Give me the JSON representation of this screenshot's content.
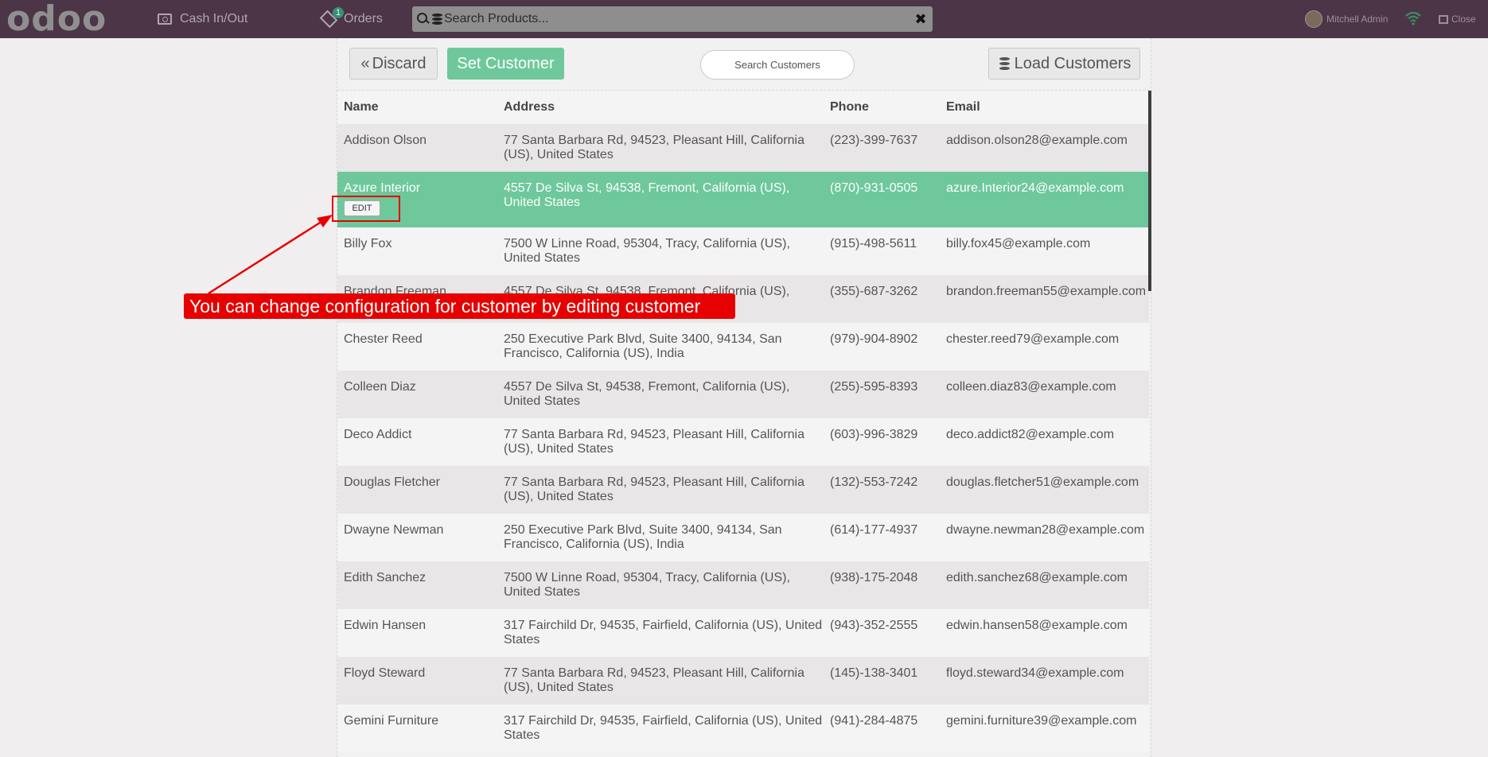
{
  "topbar": {
    "logo": "odoo",
    "cash_label": "Cash In/Out",
    "orders_label": "Orders",
    "orders_badge": "1",
    "search_placeholder": "Search Products...",
    "clear_label": "✖",
    "user_name": "Mitchell Admin",
    "close_label": "Close"
  },
  "actions": {
    "discard_label": "Discard",
    "set_customer_label": "Set Customer",
    "search_customers_placeholder": "Search Customers",
    "load_customers_label": "Load Customers"
  },
  "table": {
    "headers": [
      "Name",
      "Address",
      "Phone",
      "Email"
    ],
    "edit_label": "EDIT",
    "rows": [
      {
        "name": "Addison Olson",
        "address": "77 Santa Barbara Rd, 94523, Pleasant Hill, California (US), United States",
        "phone": "(223)-399-7637",
        "email": "addison.olson28@example.com"
      },
      {
        "name": "Azure Interior",
        "address": "4557 De Silva St, 94538, Fremont, California (US), United States",
        "phone": "(870)-931-0505",
        "email": "azure.Interior24@example.com"
      },
      {
        "name": "Billy Fox",
        "address": "7500 W Linne Road, 95304, Tracy, California (US), United States",
        "phone": "(915)-498-5611",
        "email": "billy.fox45@example.com"
      },
      {
        "name": "Brandon Freeman",
        "address": "4557 De Silva St, 94538, Fremont, California (US), United States",
        "phone": "(355)-687-3262",
        "email": "brandon.freeman55@example.com"
      },
      {
        "name": "Chester Reed",
        "address": "250 Executive Park Blvd, Suite 3400, 94134, San Francisco, California (US), India",
        "phone": "(979)-904-8902",
        "email": "chester.reed79@example.com"
      },
      {
        "name": "Colleen Diaz",
        "address": "4557 De Silva St, 94538, Fremont, California (US), United States",
        "phone": "(255)-595-8393",
        "email": "colleen.diaz83@example.com"
      },
      {
        "name": "Deco Addict",
        "address": "77 Santa Barbara Rd, 94523, Pleasant Hill, California (US), United States",
        "phone": "(603)-996-3829",
        "email": "deco.addict82@example.com"
      },
      {
        "name": "Douglas Fletcher",
        "address": "77 Santa Barbara Rd, 94523, Pleasant Hill, California (US), United States",
        "phone": "(132)-553-7242",
        "email": "douglas.fletcher51@example.com"
      },
      {
        "name": "Dwayne Newman",
        "address": "250 Executive Park Blvd, Suite 3400, 94134, San Francisco, California (US), India",
        "phone": "(614)-177-4937",
        "email": "dwayne.newman28@example.com"
      },
      {
        "name": "Edith Sanchez",
        "address": "7500 W Linne Road, 95304, Tracy, California (US), United States",
        "phone": "(938)-175-2048",
        "email": "edith.sanchez68@example.com"
      },
      {
        "name": "Edwin Hansen",
        "address": "317 Fairchild Dr, 94535, Fairfield, California (US), United States",
        "phone": "(943)-352-2555",
        "email": "edwin.hansen58@example.com"
      },
      {
        "name": "Floyd Steward",
        "address": "77 Santa Barbara Rd, 94523, Pleasant Hill, California (US), United States",
        "phone": "(145)-138-3401",
        "email": "floyd.steward34@example.com"
      },
      {
        "name": "Gemini Furniture",
        "address": "317 Fairchild Dr, 94535, Fairfield, California (US), United States",
        "phone": "(941)-284-4875",
        "email": "gemini.furniture39@example.com"
      }
    ]
  },
  "annotation": {
    "text": "You can change configuration for customer by editing customer"
  },
  "colors": {
    "topbar_bg": "#4c3547",
    "accent_green": "#6ec89b",
    "annotation_red": "#e60000"
  }
}
